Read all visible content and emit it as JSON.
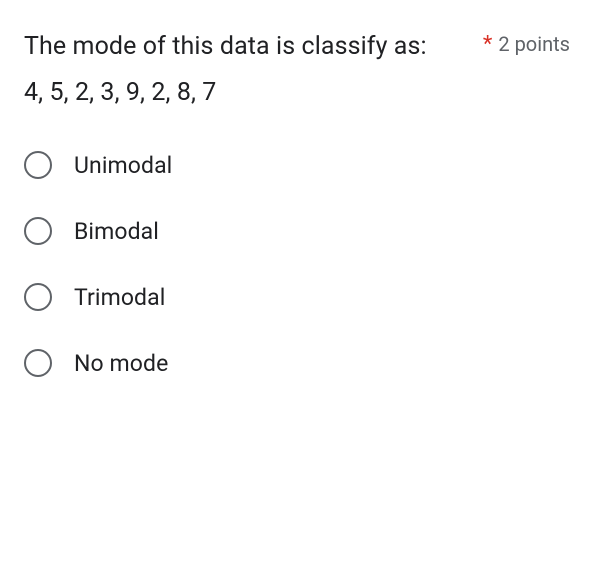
{
  "question": {
    "title": "The mode of this data is classify as:",
    "data_line": "4, 5, 2, 3, 9, 2, 8, 7",
    "required_mark": "*",
    "points_label": "2 points"
  },
  "options": [
    {
      "label": "Unimodal"
    },
    {
      "label": "Bimodal"
    },
    {
      "label": "Trimodal"
    },
    {
      "label": "No mode"
    }
  ]
}
